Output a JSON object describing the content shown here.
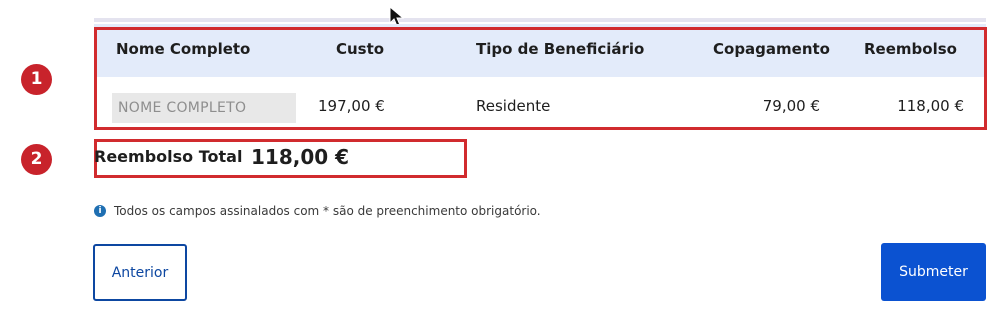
{
  "table": {
    "headers": {
      "name": "Nome Completo",
      "cost": "Custo",
      "beneficiary_type": "Tipo de Beneficiário",
      "copayment": "Copagamento",
      "reimbursement": "Reembolso"
    },
    "row": {
      "name_placeholder": "NOME COMPLETO",
      "name_value": "",
      "cost": "197,00 €",
      "beneficiary_type": "Residente",
      "copayment": "79,00 €",
      "reimbursement": "118,00 €"
    }
  },
  "total": {
    "label": "Reembolso Total",
    "value": "118,00 €"
  },
  "info": {
    "icon": "info-icon",
    "text": "Todos os campos assinalados com * são de preenchimento obrigatório."
  },
  "buttons": {
    "previous": "Anterior",
    "submit": "Submeter"
  },
  "annotations": {
    "marker_1": "1",
    "marker_2": "2",
    "highlight_color": "#d12b2e"
  },
  "colors": {
    "header_bg": "#e3ebfa",
    "primary": "#0b52d1",
    "outline": "#0d47a1"
  }
}
